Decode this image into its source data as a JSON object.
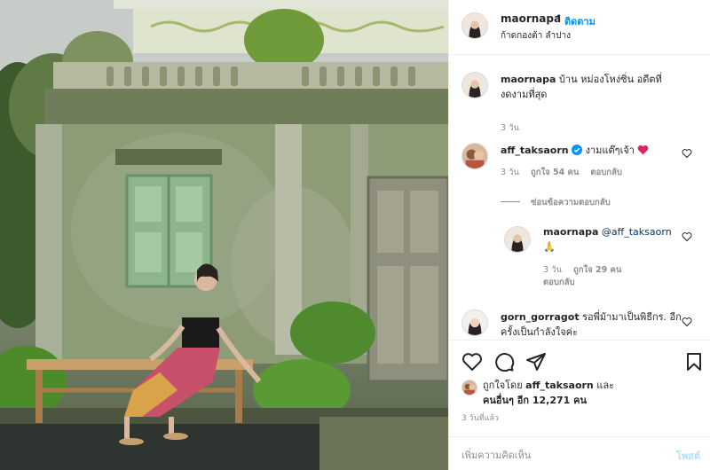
{
  "post": {
    "author": "maornapa",
    "dot": "•",
    "follow_label": "ติดตาม",
    "location": "ก้าดกองต้า ลำปาง"
  },
  "caption": {
    "username": "maornapa",
    "text": "บ้าน หม่องโหง่ซิ่น อดีตที่งดงามที่สุด",
    "time": "3 วัน"
  },
  "comments": [
    {
      "username": "aff_taksaorn",
      "verified": true,
      "text": "งามแต๊ๆเจ้า",
      "emoji": "heart",
      "time": "3 วัน",
      "likes": "ถูกใจ 54 คน",
      "reply_label": "ตอบกลับ",
      "hide_replies": "ซ่อนข้อความตอบกลับ",
      "reply": {
        "username": "maornapa",
        "mention": "@aff_taksaorn",
        "emoji": "🙏",
        "time": "3 วัน",
        "likes": "ถูกใจ 29 คน",
        "reply_label": "ตอบกลับ"
      }
    },
    {
      "username": "gorn_gorragot",
      "text": "รอพี่ม้ามาเป็นพิธีกร. อีกครั้งเป็นกำลังใจค่ะ"
    }
  ],
  "actions": {
    "liked_by_prefix": "ถูกใจโดย",
    "liked_by_user": "aff_taksaorn",
    "liked_by_and": "และ",
    "others_label": "คนอื่นๆ อีก 12,271 คน",
    "time_ago": "3 วันที่แล้ว",
    "comment_placeholder": "เพิ่มความคิดเห็น",
    "post_label": "โพสต์"
  },
  "icons": [
    "heart-icon",
    "comment-icon",
    "share-icon",
    "bookmark-icon",
    "verified-icon"
  ],
  "colors": {
    "link": "#0095f6",
    "verified": "#0095f6",
    "heart_red": "#ed4956",
    "muted": "#8e8e8e"
  }
}
